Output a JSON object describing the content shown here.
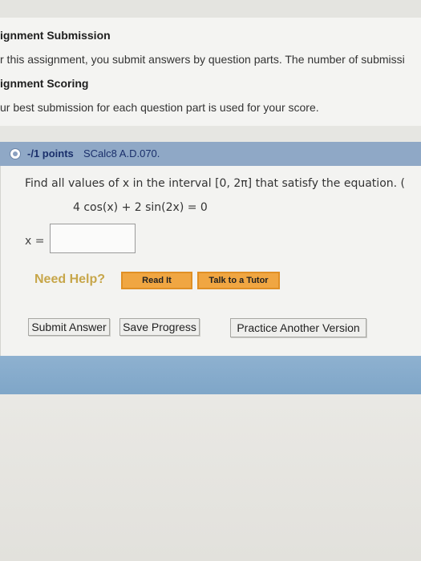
{
  "info": {
    "submission_heading": "ignment Submission",
    "submission_text": "r this assignment, you submit answers by question parts. The number of submissi",
    "scoring_heading": "ignment Scoring",
    "scoring_text": "ur best submission for each question part is used for your score."
  },
  "question": {
    "points": "-/1 points",
    "id": "SCalc8 A.D.070.",
    "prompt": "Find all values of x in the interval [0, 2π] that satisfy the equation. (",
    "equation": "4 cos(x) + 2 sin(2x) = 0",
    "answer_label": "x =",
    "answer_value": ""
  },
  "help": {
    "label": "Need Help?",
    "read_it": "Read It",
    "talk_to_tutor": "Talk to a Tutor"
  },
  "actions": {
    "submit": "Submit Answer",
    "save": "Save Progress",
    "practice": "Practice Another Version"
  },
  "colors": {
    "question_header": "#8fa8c6",
    "help_button": "#f0a642",
    "need_help_text": "#c7a64a",
    "bottom_band": "#7fa6c8"
  }
}
